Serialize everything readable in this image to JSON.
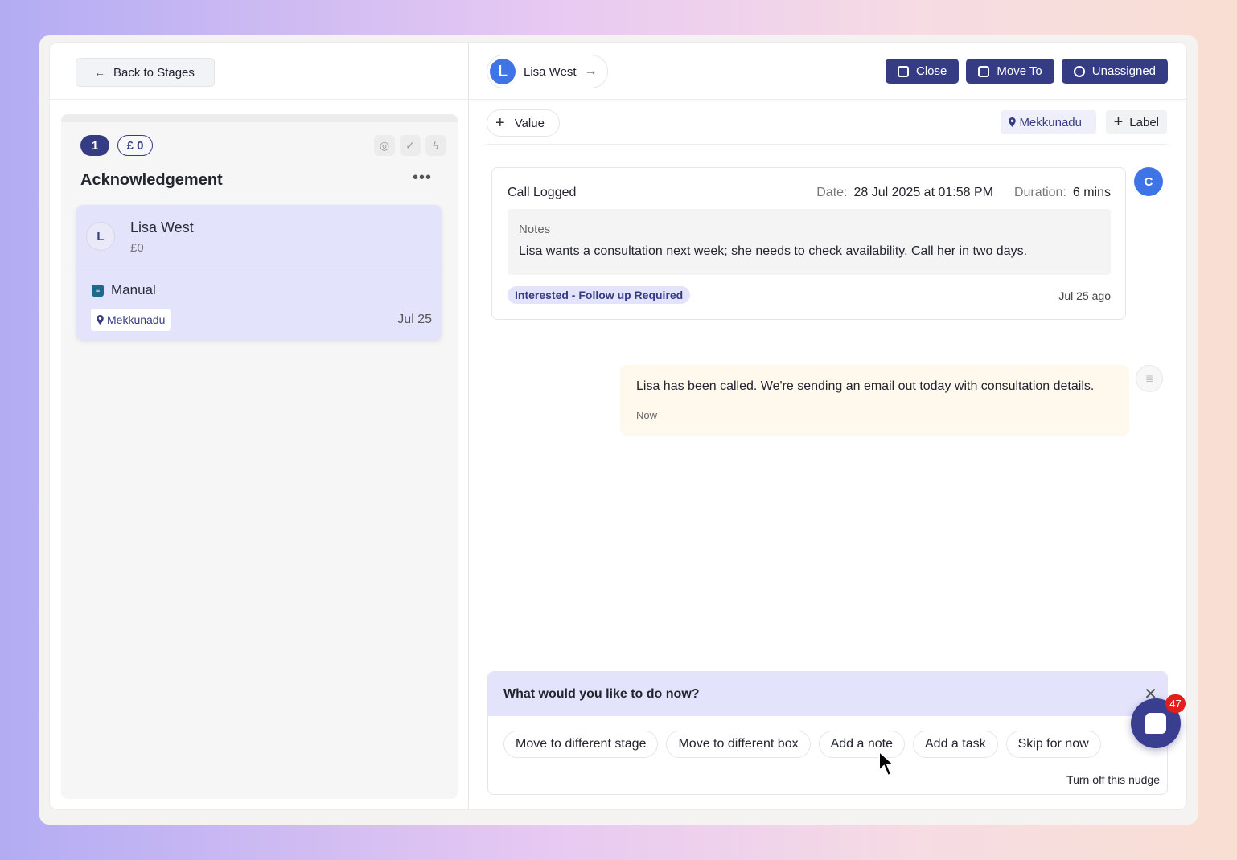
{
  "left": {
    "back_label": "Back to Stages",
    "column": {
      "count": "1",
      "value": "£ 0",
      "title": "Acknowledgement",
      "icons": [
        "target-icon",
        "check-circle-icon",
        "bolt-icon"
      ],
      "card": {
        "avatar_initial": "L",
        "name": "Lisa West",
        "value": "£0",
        "source": "Manual",
        "location": "Mekkunadu",
        "date": "Jul 25"
      }
    }
  },
  "header": {
    "contact_initial": "L",
    "contact_name": "Lisa West",
    "buttons": {
      "close": "Close",
      "move_to": "Move To",
      "assign": "Unassigned"
    }
  },
  "tags": {
    "value_label": "Value",
    "location": "Mekkunadu",
    "label_btn": "Label"
  },
  "call": {
    "title": "Call Logged",
    "date_label": "Date:",
    "date_value": "28 Jul 2025 at 01:58 PM",
    "duration_label": "Duration:",
    "duration_value": "6 mins",
    "notes_label": "Notes",
    "notes_text": "Lisa wants a consultation next week; she needs to check availability. Call her in two days.",
    "disposition": "Interested - Follow up Required",
    "ago": "Jul 25 ago",
    "avatar_initial": "C"
  },
  "note": {
    "text": "Lisa has been called. We're sending an email out today with consultation details.",
    "time": "Now"
  },
  "nudge": {
    "question": "What would you like to do now?",
    "options": [
      "Move to different stage",
      "Move to different box",
      "Add a note",
      "Add a task",
      "Skip for now"
    ],
    "turn_off": "Turn off this nudge"
  },
  "chat": {
    "badge": "47"
  },
  "colors": {
    "primary": "#363c84",
    "avatar_blue": "#3f74e6",
    "card_bg": "#e3e4fb",
    "note_bg": "#fff8ed",
    "badge_red": "#e21d1d"
  }
}
